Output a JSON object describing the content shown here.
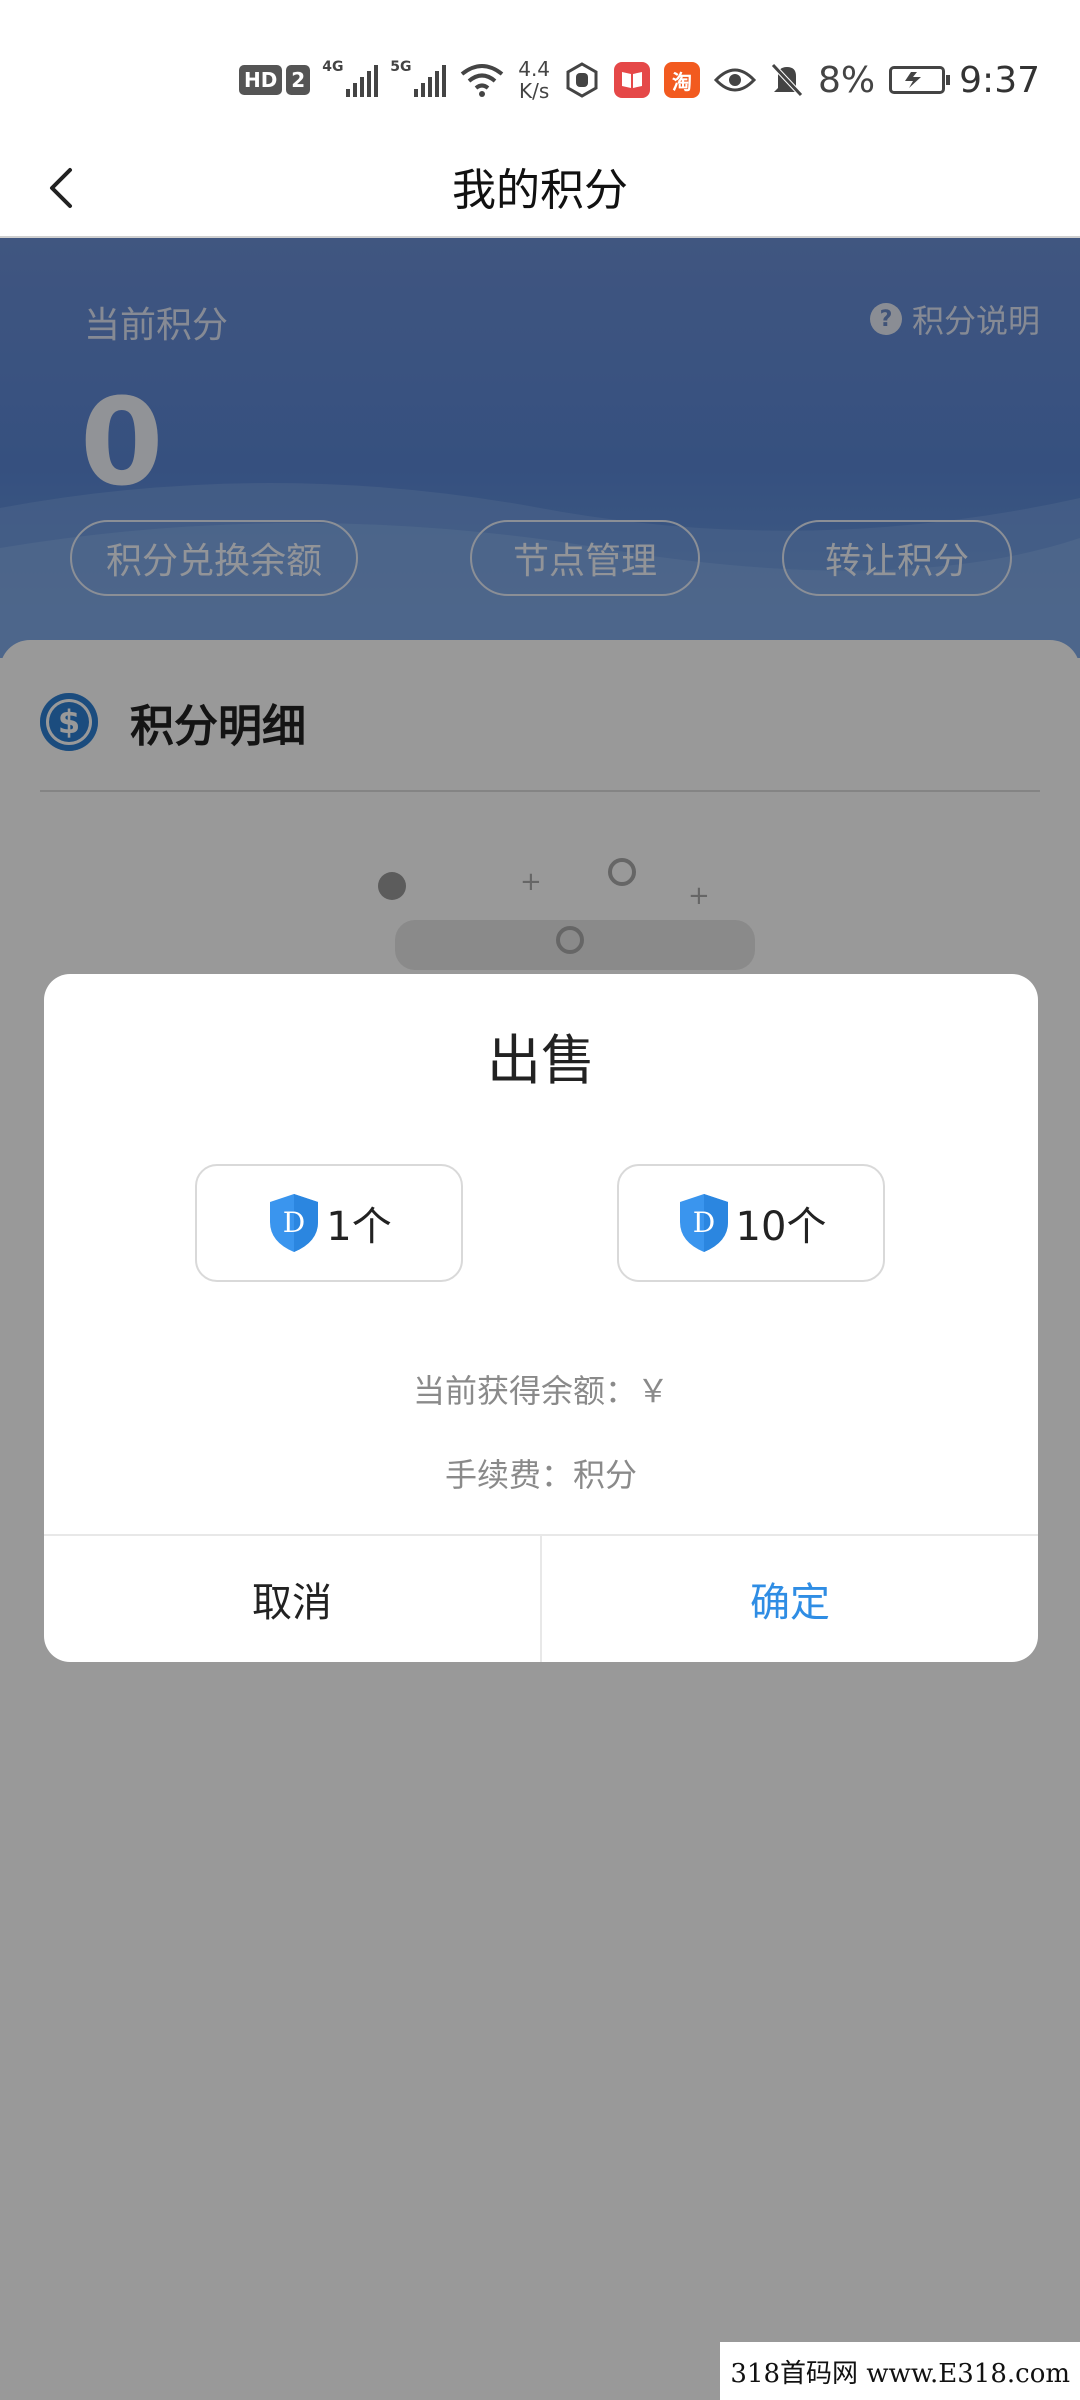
{
  "status_bar": {
    "hd_badge": "HD",
    "sim_badge": "2",
    "signal1_label": "4G",
    "signal2_label": "5G",
    "speed_value": "4.4",
    "speed_unit": "K/s",
    "taobao_icon_text": "淘",
    "battery_percent": "8%",
    "time": "9:37"
  },
  "nav": {
    "title": "我的积分"
  },
  "header": {
    "current_points_label": "当前积分",
    "help_label": "积分说明",
    "points_value": "0",
    "buttons": [
      "积分兑换余额",
      "节点管理",
      "转让积分"
    ]
  },
  "detail": {
    "coin_symbol": "$",
    "title": "积分明细"
  },
  "dialog": {
    "title": "出售",
    "options": [
      {
        "badge": "D",
        "label": "1个"
      },
      {
        "badge": "D",
        "label": "10个"
      }
    ],
    "balance_line": "当前获得余额：￥",
    "fee_line": "手续费：积分",
    "cancel_label": "取消",
    "confirm_label": "确定"
  },
  "watermark": {
    "text": "318首码网 www.E318.com"
  },
  "colors": {
    "header_blue": "#5a86d4",
    "confirm_blue": "#2f8de4",
    "shield_blue": "#3a95ee"
  }
}
